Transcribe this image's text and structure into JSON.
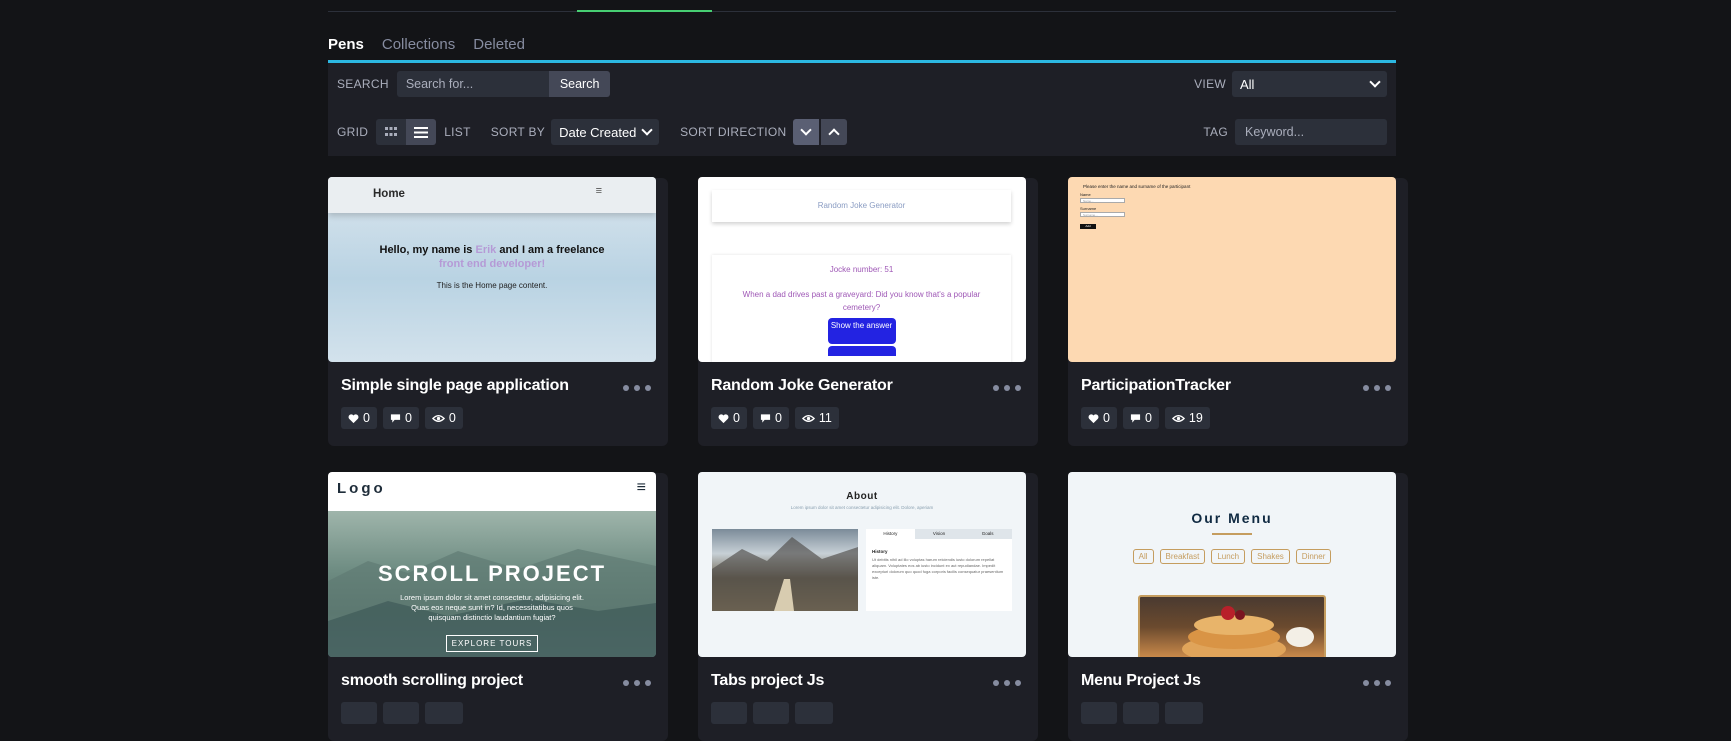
{
  "tabs": [
    {
      "label": "Pens",
      "active": true
    },
    {
      "label": "Collections",
      "active": false
    },
    {
      "label": "Deleted",
      "active": false
    }
  ],
  "filters": {
    "search_label": "SEARCH",
    "search_placeholder": "Search for...",
    "search_button": "Search",
    "view_label": "VIEW",
    "view_value": "All",
    "grid_label": "GRID",
    "list_label": "LIST",
    "sortby_label": "SORT BY",
    "sortby_value": "Date Created",
    "sortdir_label": "SORT DIRECTION",
    "tag_label": "TAG",
    "tag_placeholder": "Keyword..."
  },
  "cards": [
    {
      "title": "Simple single page application",
      "likes": "0",
      "comments": "0",
      "views": "0",
      "preview": {
        "nav": "Home",
        "line1a": "Hello, my name is ",
        "name": "Erik",
        "line1b": " and I am a freelance",
        "line2": "front end developer!",
        "text": "This is the Home page content."
      }
    },
    {
      "title": "Random Joke Generator",
      "likes": "0",
      "comments": "0",
      "views": "11",
      "preview": {
        "header": "Random Joke Generator",
        "number": "Jocke number: 51",
        "joke": "When a dad drives past a graveyard: Did you know that's a popular cemetery?",
        "button": "Show the answer"
      }
    },
    {
      "title": "ParticipationTracker",
      "likes": "0",
      "comments": "0",
      "views": "19",
      "preview": {
        "heading": "Please enter the name and surname of the participant",
        "name_label": "Name",
        "surname_label": "Surname",
        "name_ph": "Name...",
        "surname_ph": "Surname...",
        "button": "Add"
      }
    },
    {
      "title": "smooth scrolling project",
      "preview": {
        "logo": "Logo",
        "heading": "SCROLL PROJECT",
        "text": "Lorem ipsum dolor sit amet consectetur, adipisicing elit. Quas eos neque sunt in? Id, necessitatibus quos quisquam distinctio laudantium fugiat?",
        "button": "EXPLORE TOURS"
      }
    },
    {
      "title": "Tabs project Js",
      "preview": {
        "heading": "About",
        "sub": "Lorem ipsum dolor sit amet consectetur adipisicing elit. Dolore, aperiam",
        "tabs": [
          "History",
          "Vision",
          "Goals"
        ],
        "section": "History",
        "body": "Ut debitis nihil ad illo voluptas harum reiciendis iusto dolorum repellat aliquam. Voluptates eos ab iusto incidunt ex aut repudiandae. Impedit excepturi dolorum quo quod fuga corporis facilis consequatur praesentium iste."
      }
    },
    {
      "title": "Menu Project Js",
      "preview": {
        "heading": "Our Menu",
        "filters": [
          "All",
          "Breakfast",
          "Lunch",
          "Shakes",
          "Dinner"
        ]
      }
    }
  ]
}
